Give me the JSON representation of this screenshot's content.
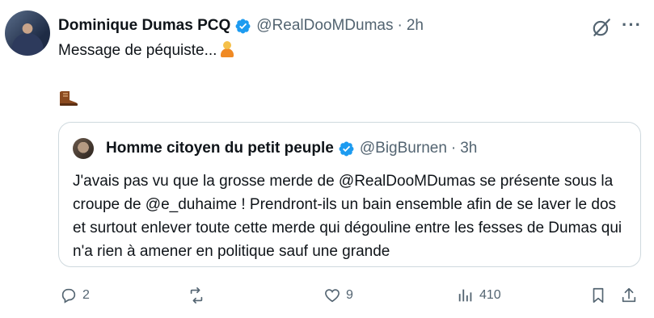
{
  "post": {
    "author_name": "Dominique Dumas PCQ",
    "handle": "@RealDooMDumas",
    "separator": "·",
    "time": "2h",
    "text": "Message de péquiste..."
  },
  "quote": {
    "author_name": "Homme citoyen du petit peuple",
    "handle": "@BigBurnen",
    "separator": "·",
    "time": "3h",
    "text": "J'avais pas vu que la grosse merde de @RealDooMDumas se présente sous la croupe de @e_duhaime ! Prendront-ils un bain ensemble afin de se laver le dos et surtout enlever toute cette merde qui dégouline entre les fesses de Dumas qui n'a rien à amener en politique sauf une grande"
  },
  "actions": {
    "replies": "2",
    "likes": "9",
    "views": "410"
  },
  "icons": {
    "verified": "verified-badge-icon",
    "grok": "grok-icon",
    "more": "more-icon",
    "reply": "reply-icon",
    "repost": "repost-icon",
    "like": "heart-icon",
    "views": "views-icon",
    "bookmark": "bookmark-icon",
    "share": "share-icon"
  },
  "colors": {
    "verified": "#1d9bf0",
    "secondary_text": "#536471",
    "border": "#cfd9de"
  }
}
